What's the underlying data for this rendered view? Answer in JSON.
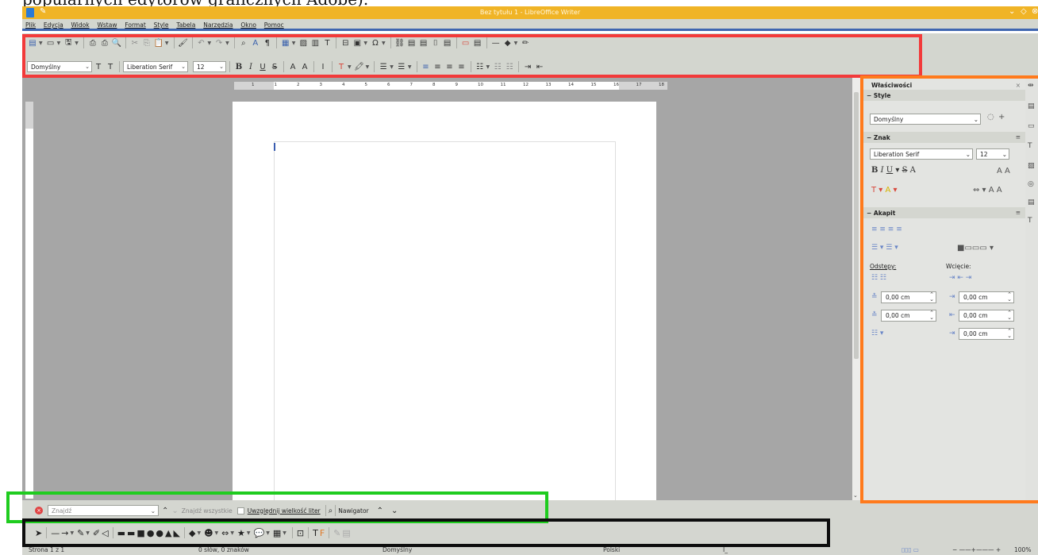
{
  "caption": "popularnych edytorów graficznych Adobe).",
  "window": {
    "title": "Bez tytułu 1 - LibreOffice Writer"
  },
  "menu": [
    "Plik",
    "Edycja",
    "Widok",
    "Wstaw",
    "Format",
    "Style",
    "Tabela",
    "Narzędzia",
    "Okno",
    "Pomoc"
  ],
  "format_toolbar": {
    "paragraph_style": "Domyślny",
    "font_name": "Liberation Serif",
    "font_size": "12",
    "bold": "B",
    "italic": "I",
    "underline": "U",
    "strike": "S"
  },
  "ruler": {
    "marks": [
      "1",
      "1",
      "2",
      "3",
      "4",
      "5",
      "6",
      "7",
      "8",
      "9",
      "10",
      "11",
      "12",
      "13",
      "14",
      "15",
      "16",
      "17",
      "18"
    ]
  },
  "sidebar": {
    "title": "Właściwości",
    "style_section": "Style",
    "style_value": "Domyślny",
    "char_section": "Znak",
    "char_font": "Liberation Serif",
    "char_size": "12",
    "para_section": "Akapit",
    "spacing_label": "Odstępy:",
    "indent_label": "Wcięcie:",
    "above": "0,00 cm",
    "below": "0,00 cm",
    "indent_before": "0,00 cm",
    "indent_after": "0,00 cm",
    "indent_first": "0,00 cm"
  },
  "findbar": {
    "placeholder": "Znajdź",
    "find_all": "Znajdź wszystkie",
    "match_case": "Uwzględnij wielkość liter",
    "navigator": "Nawigator"
  },
  "status": {
    "page": "Strona 1 z 1",
    "words": "0 słów, 0 znaków",
    "style": "Domyślny",
    "language": "Polski",
    "zoom": "100%"
  },
  "colors": {
    "accent": "#3f66b0",
    "titlebar": "#f0b426",
    "highlight_red": "#f23a3a",
    "highlight_orange": "#ff7a1c",
    "highlight_green": "#1fcc1f"
  }
}
